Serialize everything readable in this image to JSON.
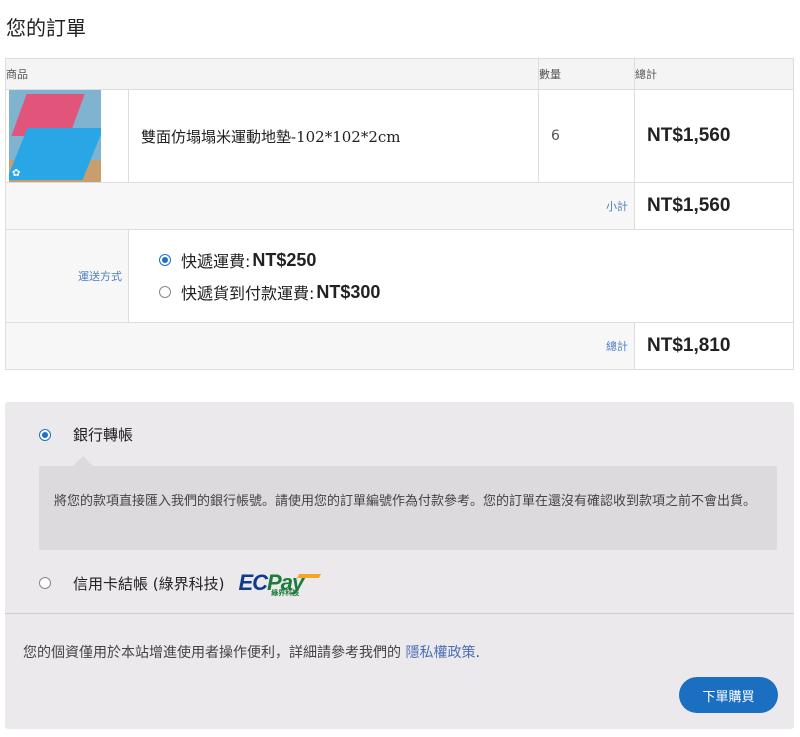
{
  "page": {
    "title": "您的訂單"
  },
  "table": {
    "headers": {
      "product": "商品",
      "quantity": "數量",
      "total": "總計"
    },
    "item": {
      "name": "雙面仿塌塌米運動地墊-102*102*2cm",
      "quantity": "6",
      "price": "NT$1,560"
    },
    "subtotal": {
      "label": "小計",
      "value": "NT$1,560"
    },
    "shipping": {
      "label": "運送方式",
      "options": [
        {
          "label": "快遞運費:",
          "price": "NT$250",
          "selected": true
        },
        {
          "label": "快遞貨到付款運費:",
          "price": "NT$300",
          "selected": false
        }
      ]
    },
    "grand_total": {
      "label": "總計",
      "value": "NT$1,810"
    }
  },
  "payment": {
    "bank": {
      "label": "銀行轉帳",
      "selected": true,
      "description": "將您的款項直接匯入我們的銀行帳號。請使用您的訂單編號作為付款參考。您的訂單在還沒有確認收到款項之前不會出貨。"
    },
    "card": {
      "label": "信用卡結帳 (綠界科技)",
      "selected": false,
      "logo_text_ec": "EC",
      "logo_text_pay": "Pay",
      "logo_sub": "綠界科技"
    }
  },
  "privacy": {
    "text": "您的個資僅用於本站增進使用者操作便利，詳細請參考我們的 ",
    "link": "隱私權政策",
    "suffix": "."
  },
  "place_order": {
    "label": "下單購買"
  }
}
